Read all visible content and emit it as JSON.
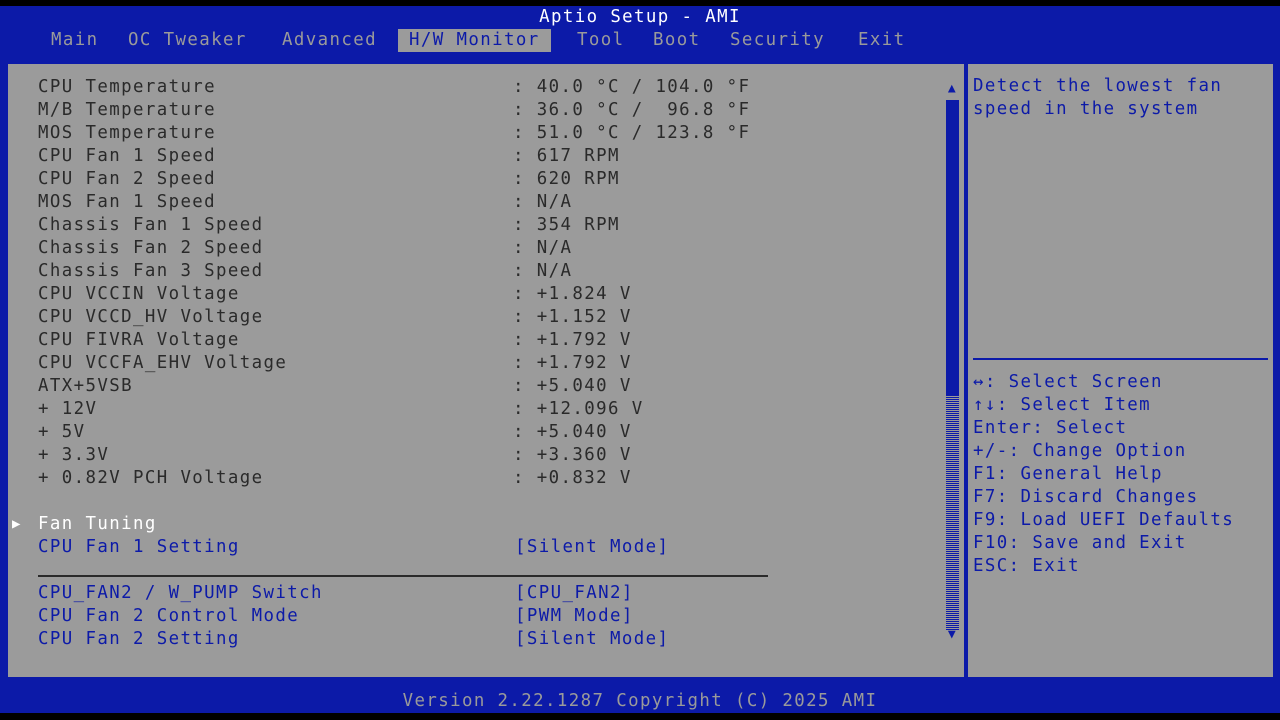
{
  "header": {
    "title": "Aptio Setup - AMI",
    "tabs": [
      "Main",
      "OC Tweaker",
      "Advanced",
      "H/W Monitor",
      "Tool",
      "Boot",
      "Security",
      "Exit"
    ],
    "active_tab": "H/W Monitor"
  },
  "monitor": [
    {
      "label": "CPU Temperature",
      "value": ": 40.0 °C / 104.0 °F"
    },
    {
      "label": "M/B Temperature",
      "value": ": 36.0 °C /  96.8 °F"
    },
    {
      "label": "MOS Temperature",
      "value": ": 51.0 °C / 123.8 °F"
    },
    {
      "label": "CPU Fan 1 Speed",
      "value": ": 617 RPM"
    },
    {
      "label": "CPU Fan 2 Speed",
      "value": ": 620 RPM"
    },
    {
      "label": "MOS Fan 1 Speed",
      "value": ": N/A"
    },
    {
      "label": "Chassis Fan 1 Speed",
      "value": ": 354 RPM"
    },
    {
      "label": "Chassis Fan 2 Speed",
      "value": ": N/A"
    },
    {
      "label": "Chassis Fan 3 Speed",
      "value": ": N/A"
    },
    {
      "label": "CPU VCCIN Voltage",
      "value": ": +1.824 V"
    },
    {
      "label": "CPU VCCD_HV Voltage",
      "value": ": +1.152 V"
    },
    {
      "label": "CPU FIVRA Voltage",
      "value": ": +1.792 V"
    },
    {
      "label": "CPU VCCFA_EHV Voltage",
      "value": ": +1.792 V"
    },
    {
      "label": "ATX+5VSB",
      "value": ": +5.040 V"
    },
    {
      "label": "+ 12V",
      "value": ": +12.096 V"
    },
    {
      "label": "+ 5V",
      "value": ": +5.040 V"
    },
    {
      "label": "+ 3.3V",
      "value": ": +3.360 V"
    },
    {
      "label": "+ 0.82V PCH Voltage",
      "value": ": +0.832 V"
    }
  ],
  "fan_tuning": {
    "label": "Fan Tuning",
    "cpu_fan1_setting": {
      "label": "CPU Fan 1 Setting",
      "value": "[Silent Mode]"
    },
    "cpu_fan2_switch": {
      "label": "CPU_FAN2 / W_PUMP Switch",
      "value": "[CPU_FAN2]"
    },
    "cpu_fan2_mode": {
      "label": "CPU Fan 2 Control Mode",
      "value": "[PWM Mode]"
    },
    "cpu_fan2_setting": {
      "label": "CPU Fan 2 Setting",
      "value": "[Silent Mode]"
    }
  },
  "help": {
    "description": "Detect the lowest fan speed in the system",
    "keys": [
      "↔: Select Screen",
      "↑↓: Select Item",
      "Enter: Select",
      "+/-: Change Option",
      "F1: General Help",
      "F7: Discard Changes",
      "F9: Load UEFI Defaults",
      "F10: Save and Exit",
      "ESC: Exit"
    ]
  },
  "footer": {
    "version": "Version 2.22.1287 Copyright (C) 2025 AMI"
  },
  "colors": {
    "bios_blue": "#0c1aa8",
    "panel_gray": "#9b9b9b",
    "text_dark": "#2a2a2a",
    "highlight_white": "#ffffff"
  }
}
